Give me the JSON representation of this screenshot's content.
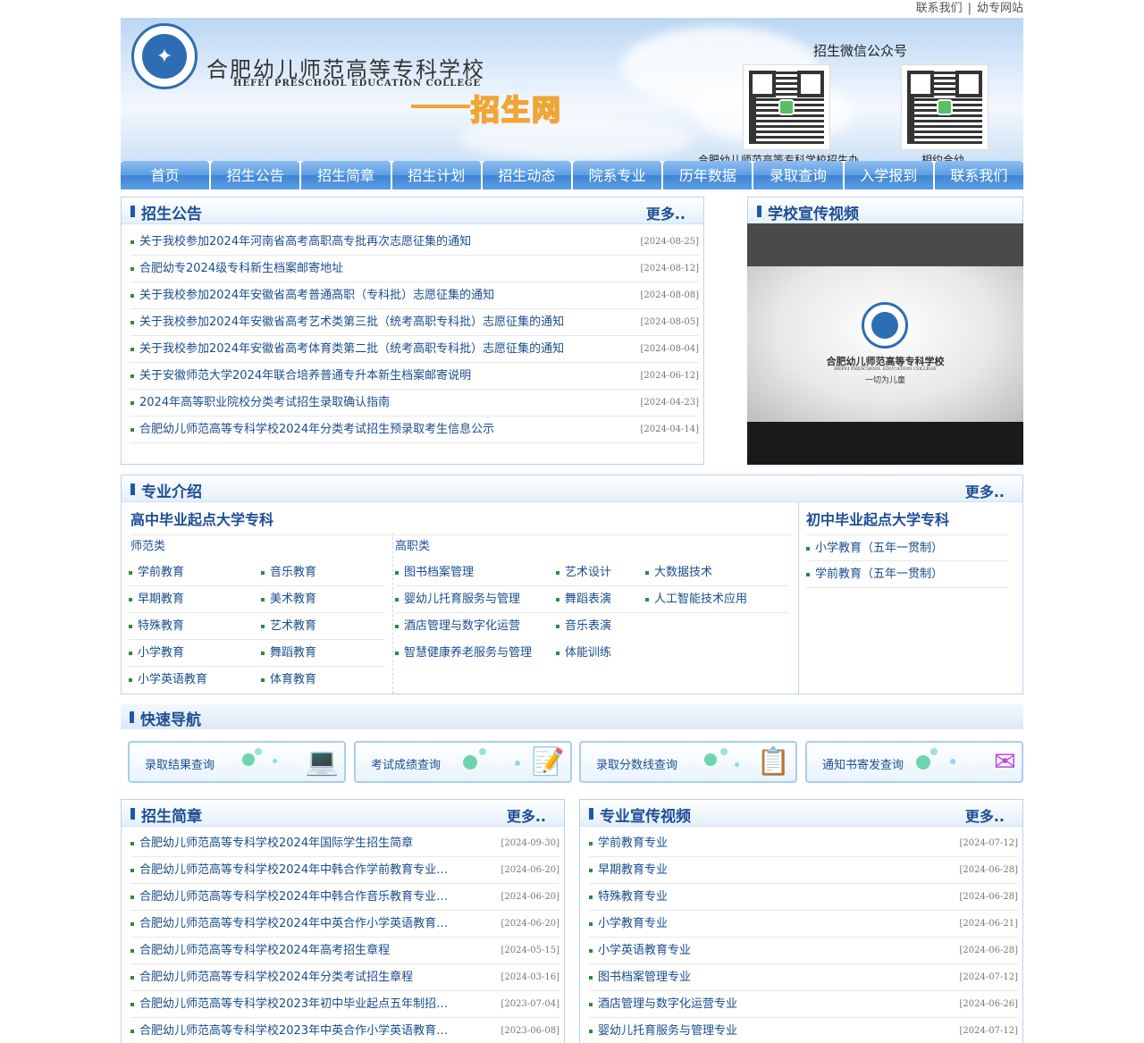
{
  "toplinks": {
    "contact": "联系我们",
    "separator": "|",
    "site": "幼专网站"
  },
  "banner": {
    "school_cn": "合肥幼儿师范高等专科学校",
    "school_en": "HEFEI PRESCHOOL EDUCATION COLLEGE",
    "zsw": "招生网",
    "qr_title": "招生微信公众号",
    "qr1_caption": "合肥幼儿师范高等专科学校招生办",
    "qr2_caption": "相约合幼"
  },
  "nav": [
    "首页",
    "招生公告",
    "招生简章",
    "招生计划",
    "招生动态",
    "院系专业",
    "历年数据",
    "录取查询",
    "入学报到",
    "联系我们"
  ],
  "notices": {
    "title": "招生公告",
    "more": "更多..",
    "items": [
      {
        "text": "关于我校参加2024年河南省高考高职高专批再次志愿征集的通知",
        "date": "[2024-08-25]"
      },
      {
        "text": "合肥幼专2024级专科新生档案邮寄地址",
        "date": "[2024-08-12]"
      },
      {
        "text": "关于我校参加2024年安徽省高考普通高职（专科批）志愿征集的通知",
        "date": "[2024-08-08]"
      },
      {
        "text": "关于我校参加2024年安徽省高考艺术类第三批（统考高职专科批）志愿征集的通知",
        "date": "[2024-08-05]"
      },
      {
        "text": "关于我校参加2024年安徽省高考体育类第二批（统考高职专科批）志愿征集的通知",
        "date": "[2024-08-04]"
      },
      {
        "text": "关于安徽师范大学2024年联合培养普通专升本新生档案邮寄说明",
        "date": "[2024-06-12]"
      },
      {
        "text": "2024年高等职业院校分类考试招生录取确认指南",
        "date": "[2024-04-23]"
      },
      {
        "text": "合肥幼儿师范高等专科学校2024年分类考试招生预录取考生信息公示",
        "date": "[2024-04-14]"
      }
    ]
  },
  "video_box": {
    "title": "学校宣传视频",
    "video_text1": "合肥幼儿师范高等专科学校",
    "video_text2": "HEFEI PRESCHOOL EDUCATION COLLEGE",
    "video_text3": "一切为儿童"
  },
  "majors": {
    "title": "专业介绍",
    "more": "更多..",
    "high_title": "高中毕业起点大学专科",
    "normal_label": "师范类",
    "voc_label": "高职类",
    "normal_col1": [
      "学前教育",
      "早期教育",
      "特殊教育",
      "小学教育",
      "小学英语教育"
    ],
    "normal_col2": [
      "音乐教育",
      "美术教育",
      "艺术教育",
      "舞蹈教育",
      "体育教育"
    ],
    "voc_col1": [
      "图书档案管理",
      "婴幼儿托育服务与管理",
      "酒店管理与数字化运营",
      "智慧健康养老服务与管理"
    ],
    "voc_col2": [
      "艺术设计",
      "舞蹈表演",
      "音乐表演",
      "体能训练"
    ],
    "voc_col3": [
      "大数据技术",
      "人工智能技术应用"
    ],
    "junior_title": "初中毕业起点大学专科",
    "junior_items": [
      "小学教育（五年一贯制）",
      "学前教育（五年一贯制）"
    ]
  },
  "quick_nav": {
    "title": "快速导航",
    "buttons": [
      "录取结果查询",
      "考试成绩查询",
      "录取分数线查询",
      "通知书寄发查询"
    ]
  },
  "brochure": {
    "title": "招生简章",
    "more": "更多..",
    "items": [
      {
        "text": "合肥幼儿师范高等专科学校2024年国际学生招生简章",
        "date": "[2024-09-30]"
      },
      {
        "text": "合肥幼儿师范高等专科学校2024年中韩合作学前教育专业…",
        "date": "[2024-06-20]"
      },
      {
        "text": "合肥幼儿师范高等专科学校2024年中韩合作音乐教育专业…",
        "date": "[2024-06-20]"
      },
      {
        "text": "合肥幼儿师范高等专科学校2024年中英合作小学英语教育…",
        "date": "[2024-06-20]"
      },
      {
        "text": "合肥幼儿师范高等专科学校2024年高考招生章程",
        "date": "[2024-05-15]"
      },
      {
        "text": "合肥幼儿师范高等专科学校2024年分类考试招生章程",
        "date": "[2024-03-16]"
      },
      {
        "text": "合肥幼儿师范高等专科学校2023年初中毕业起点五年制招…",
        "date": "[2023-07-04]"
      },
      {
        "text": "合肥幼儿师范高等专科学校2023年中英合作小学英语教育…",
        "date": "[2023-06-08]"
      }
    ]
  },
  "major_videos": {
    "title": "专业宣传视频",
    "more": "更多..",
    "items": [
      {
        "text": "学前教育专业",
        "date": "[2024-07-12]"
      },
      {
        "text": "早期教育专业",
        "date": "[2024-06-28]"
      },
      {
        "text": "特殊教育专业",
        "date": "[2024-06-28]"
      },
      {
        "text": "小学教育专业",
        "date": "[2024-06-21]"
      },
      {
        "text": "小学英语教育专业",
        "date": "[2024-06-28]"
      },
      {
        "text": "图书档案管理专业",
        "date": "[2024-07-12]"
      },
      {
        "text": "酒店管理与数字化运营专业",
        "date": "[2024-06-26]"
      },
      {
        "text": "婴幼儿托育服务与管理专业",
        "date": "[2024-07-12]"
      }
    ]
  }
}
